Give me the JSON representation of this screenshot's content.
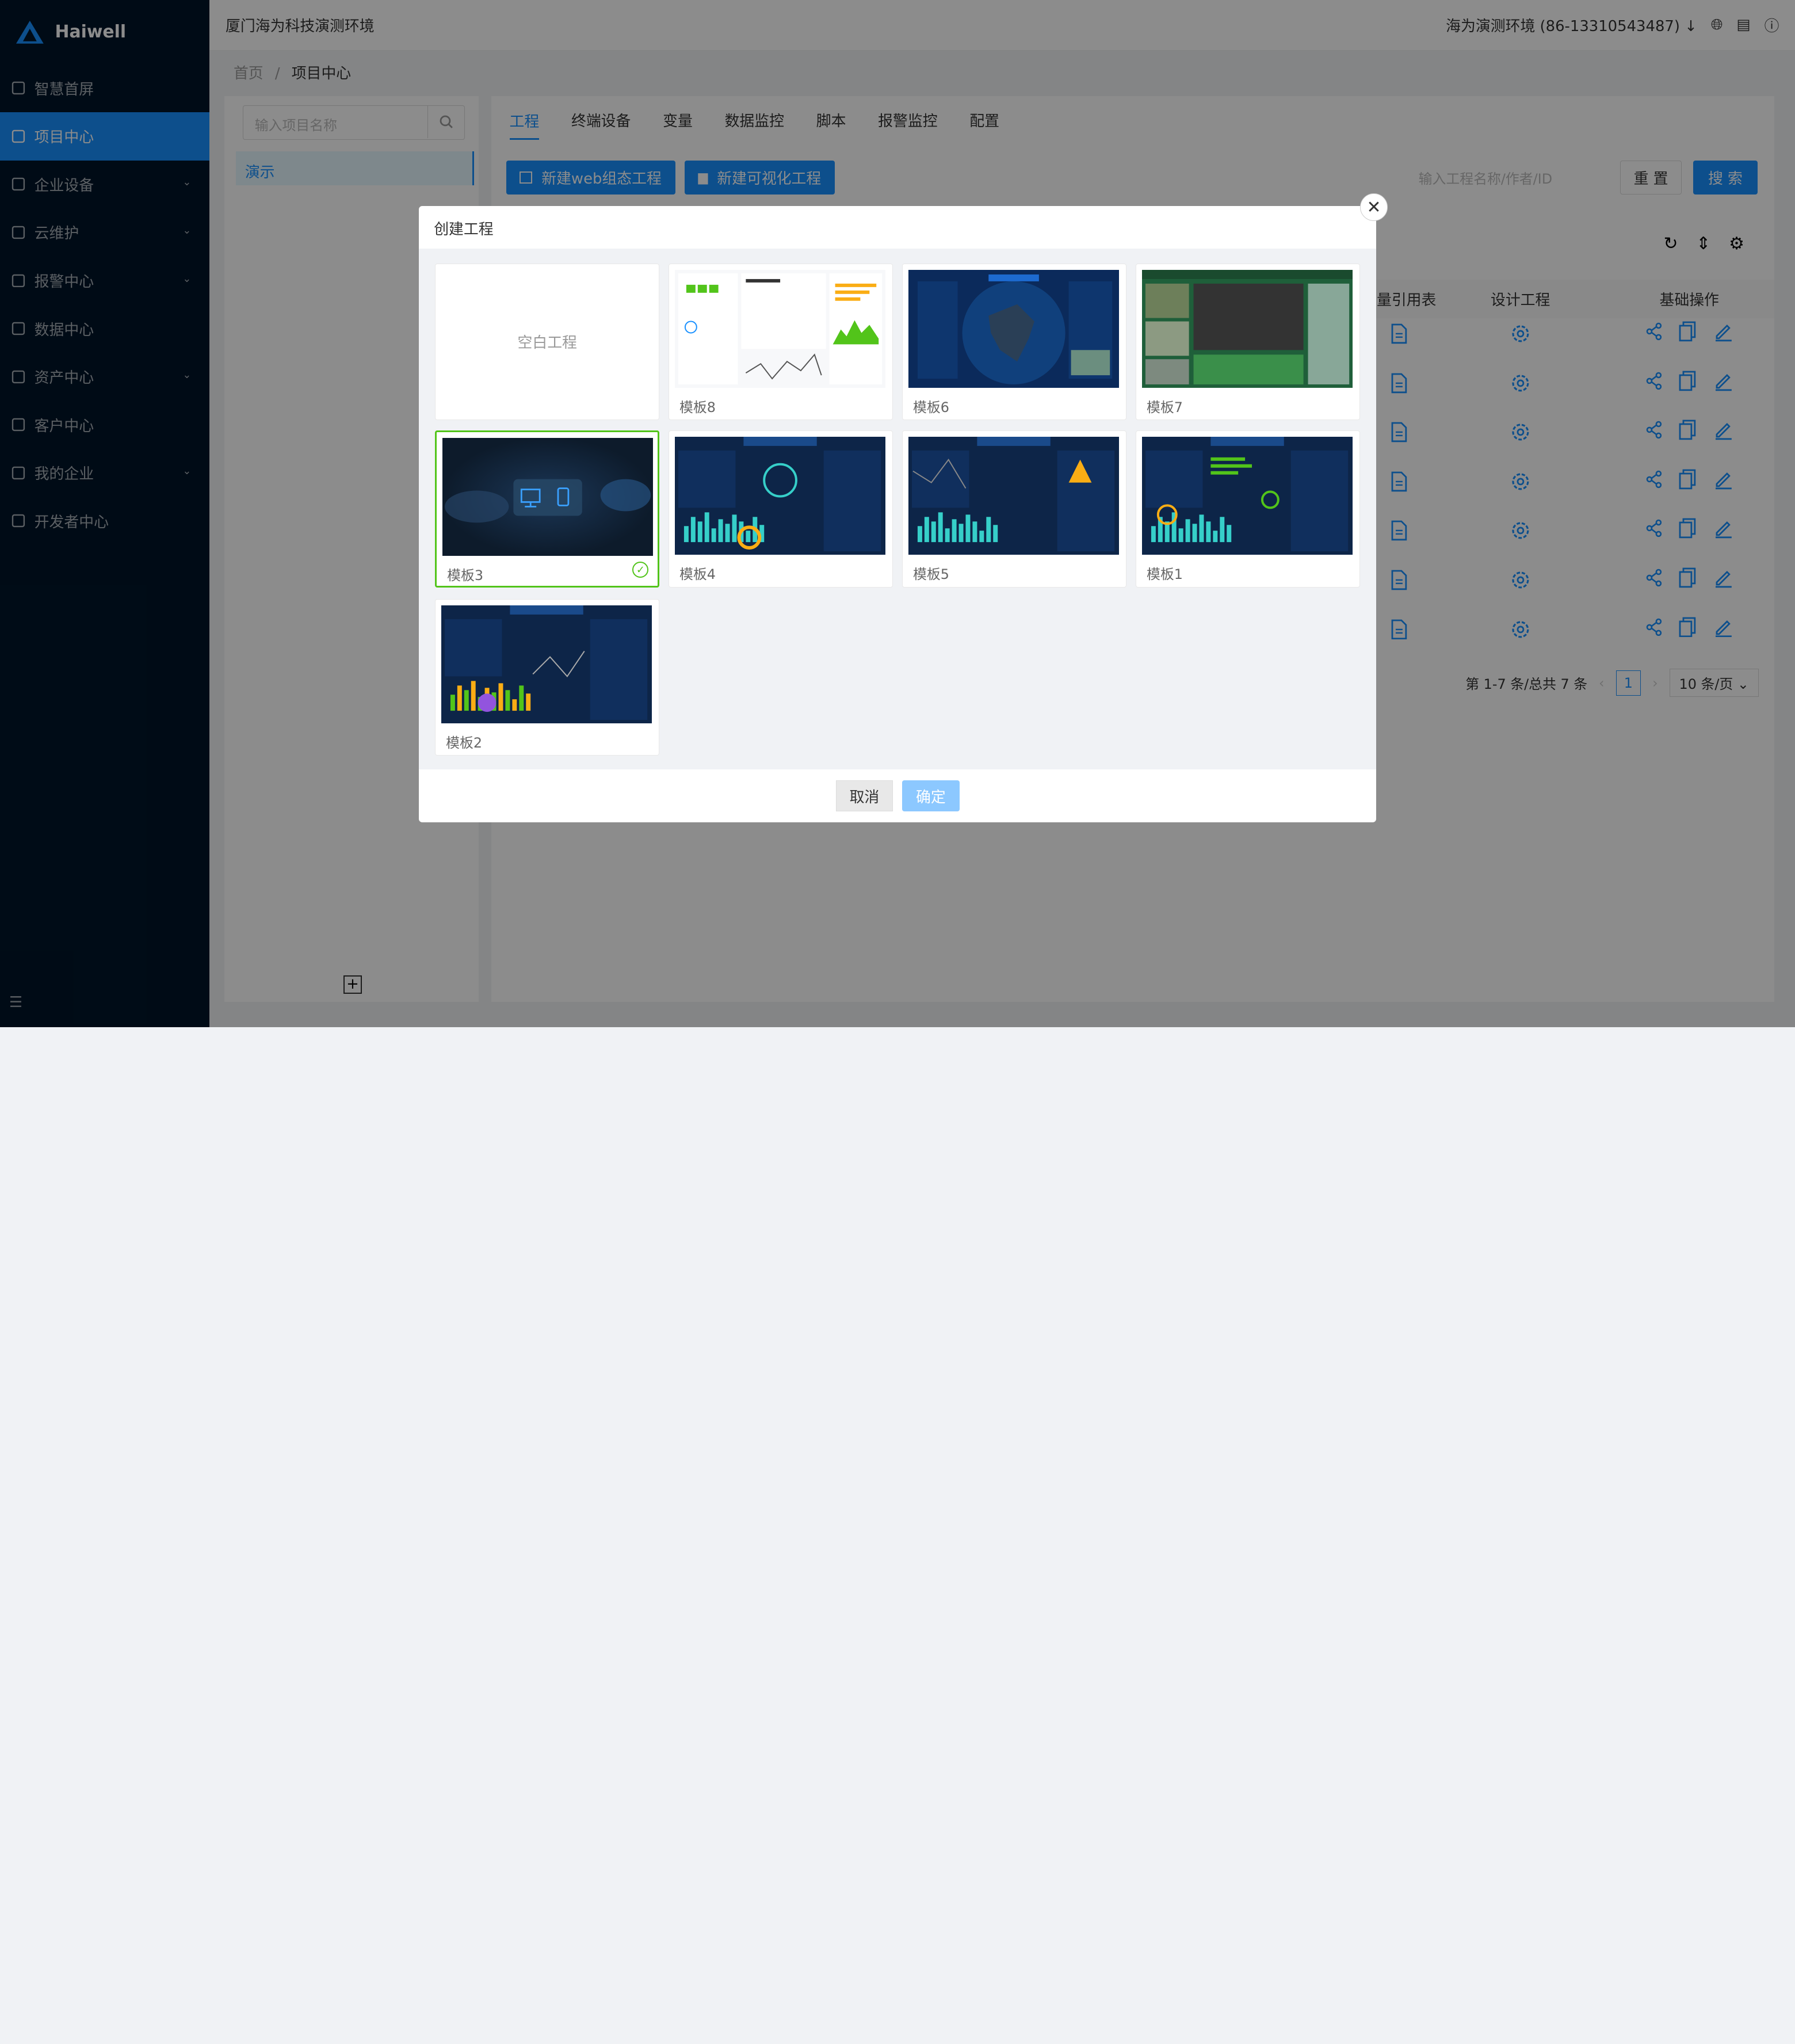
{
  "brand": {
    "name": "Haiwell"
  },
  "sidebar": {
    "items": [
      {
        "label": "智慧首屏",
        "icon": "globe-icon",
        "active": false,
        "arrow": false
      },
      {
        "label": "项目中心",
        "icon": "project-icon",
        "active": true,
        "arrow": false
      },
      {
        "label": "企业设备",
        "icon": "monitor-icon",
        "active": false,
        "arrow": true
      },
      {
        "label": "云维护",
        "icon": "cloud-icon",
        "active": false,
        "arrow": true
      },
      {
        "label": "报警中心",
        "icon": "bell-icon",
        "active": false,
        "arrow": true
      },
      {
        "label": "数据中心",
        "icon": "data-icon",
        "active": false,
        "arrow": false
      },
      {
        "label": "资产中心",
        "icon": "asset-icon",
        "active": false,
        "arrow": true
      },
      {
        "label": "客户中心",
        "icon": "customer-icon",
        "active": false,
        "arrow": false
      },
      {
        "label": "我的企业",
        "icon": "home-icon",
        "active": false,
        "arrow": true
      },
      {
        "label": "开发者中心",
        "icon": "developer-icon",
        "active": false,
        "arrow": false
      }
    ]
  },
  "topbar": {
    "title": "厦门海为科技演测环境",
    "env": "海为演测环境 (86-13310543487)"
  },
  "breadcrumb": {
    "home": "首页",
    "sep": "/",
    "current": "项目中心"
  },
  "left_panel": {
    "search_placeholder": "输入项目名称",
    "item": "演示"
  },
  "tabs": [
    "工程",
    "终端设备",
    "变量",
    "数据监控",
    "脚本",
    "报警监控",
    "配置"
  ],
  "actions": {
    "new_web": "新建web组态工程",
    "new_vis": "新建可视化工程",
    "search_placeholder": "输入工程名称/作者/ID",
    "reset": "重 置",
    "search": "搜 索"
  },
  "table": {
    "headers": [
      "变量引用表",
      "设计工程",
      "基础操作"
    ],
    "row_count": 7
  },
  "pager": {
    "summary": "第 1-7 条/总共 7 条",
    "page": "1",
    "size": "10 条/页"
  },
  "modal": {
    "title": "创建工程",
    "cancel": "取消",
    "confirm": "确定",
    "cards": [
      {
        "label": "空白工程",
        "blank": true,
        "selected": false
      },
      {
        "label": "模板8",
        "theme": "light",
        "selected": false
      },
      {
        "label": "模板6",
        "theme": "map",
        "selected": false
      },
      {
        "label": "模板7",
        "theme": "farm",
        "selected": false
      },
      {
        "label": "模板3",
        "theme": "blur",
        "selected": true
      },
      {
        "label": "模板4",
        "theme": "dark",
        "selected": false
      },
      {
        "label": "模板5",
        "theme": "dark2",
        "selected": false
      },
      {
        "label": "模板1",
        "theme": "dark3",
        "selected": false
      },
      {
        "label": "模板2",
        "theme": "dark4",
        "selected": false
      }
    ]
  },
  "colors": {
    "primary": "#1890ff",
    "sidebar": "#001529",
    "success": "#52c41a"
  }
}
